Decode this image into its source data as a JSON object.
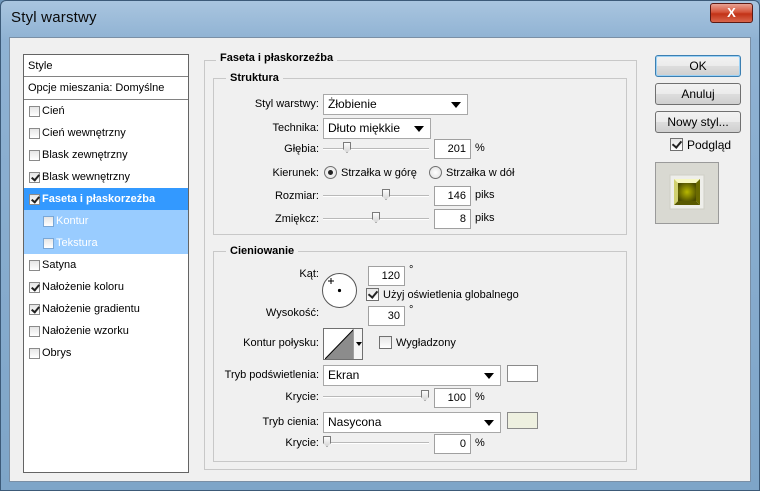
{
  "window": {
    "title": "Styl warstwy",
    "close_glyph": "X"
  },
  "style_list": {
    "header": "Style",
    "blend_options": "Opcje mieszania: Domyślne",
    "items": [
      {
        "label": "Cień",
        "checked": false
      },
      {
        "label": "Cień wewnętrzny",
        "checked": false
      },
      {
        "label": "Blask zewnętrzny",
        "checked": false
      },
      {
        "label": "Blask wewnętrzny",
        "checked": true
      },
      {
        "label": "Faseta i płaskorzeźba",
        "checked": true,
        "selected": true
      },
      {
        "label": "Kontur",
        "checked": false,
        "sub": true
      },
      {
        "label": "Tekstura",
        "checked": false,
        "sub": true
      },
      {
        "label": "Satyna",
        "checked": false
      },
      {
        "label": "Nałożenie koloru",
        "checked": true
      },
      {
        "label": "Nałożenie gradientu",
        "checked": true
      },
      {
        "label": "Nałożenie wzorku",
        "checked": false
      },
      {
        "label": "Obrys",
        "checked": false
      }
    ]
  },
  "main": {
    "section_title": "Faseta i płaskorzeźba",
    "structure": {
      "title": "Struktura",
      "style_label": "Styl warstwy:",
      "style_value": "Żłobienie",
      "technique_label": "Technika:",
      "technique_value": "Dłuto miękkie",
      "depth_label": "Głębia:",
      "depth_value": "201",
      "depth_unit": "%",
      "depth_level": 0.2,
      "direction_label": "Kierunek:",
      "direction_up": "Strzałka w górę",
      "direction_down": "Strzałka w dół",
      "direction_selected": "up",
      "size_label": "Rozmiar:",
      "size_value": "146",
      "size_unit": "piks",
      "size_level": 0.6,
      "soften_label": "Zmiękcz:",
      "soften_value": "8",
      "soften_unit": "piks",
      "soften_level": 0.5
    },
    "shading": {
      "title": "Cieniowanie",
      "angle_label": "Kąt:",
      "angle_value": "120",
      "angle_unit": "°",
      "global_light_label": "Użyj oświetlenia globalnego",
      "global_light_checked": true,
      "altitude_label": "Wysokość:",
      "altitude_value": "30",
      "altitude_unit": "°",
      "gloss_label": "Kontur połysku:",
      "antialias_label": "Wygładzony",
      "antialias_checked": false,
      "highlight_mode_label": "Tryb podświetlenia:",
      "highlight_mode_value": "Ekran",
      "highlight_color": "#ffffff",
      "highlight_opacity_label": "Krycie:",
      "highlight_opacity_value": "100",
      "highlight_opacity_unit": "%",
      "highlight_opacity_level": 1.0,
      "shadow_mode_label": "Tryb cienia:",
      "shadow_mode_value": "Nasycona",
      "shadow_color": "#eef0e0",
      "shadow_opacity_label": "Krycie:",
      "shadow_opacity_value": "0",
      "shadow_opacity_unit": "%",
      "shadow_opacity_level": 0.0
    }
  },
  "buttons": {
    "ok": "OK",
    "cancel": "Anuluj",
    "new_style": "Nowy styl...",
    "preview_label": "Podgląd",
    "preview_checked": true
  },
  "colors": {
    "selected_bg": "#3399ff",
    "sub_bg": "#99ccff",
    "preview_gem": "#8a8a00"
  },
  "icons": {
    "close": "close-icon",
    "contour": "gloss-contour-icon",
    "angle": "angle-dial-icon"
  }
}
